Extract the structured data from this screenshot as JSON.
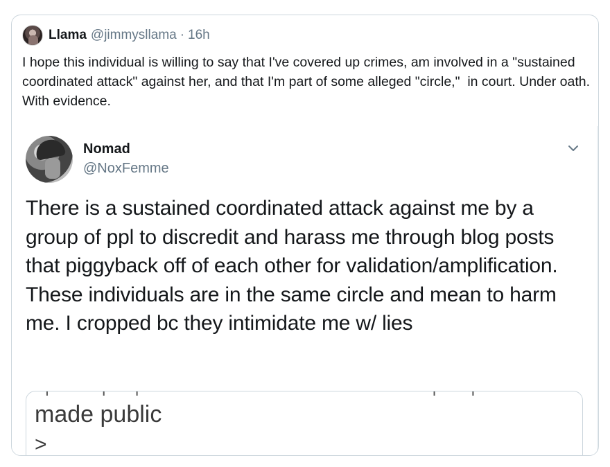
{
  "quote_tweet": {
    "name": "Llama",
    "handle": "@jimmysllama",
    "separator": "·",
    "time": "16h",
    "text": "I hope this individual is willing to say that I've covered up crimes, am involved in a \"sustained coordinated attack\" against her, and that I'm part of some alleged \"circle,\"  in court. Under oath. With evidence."
  },
  "embedded_tweet": {
    "name": "Nomad",
    "handle": "@NoxFemme",
    "text": "There is a sustained coordinated attack against me by a group of ppl to discredit and harass me through blog posts that piggyback off of each other for validation/amplification. These individuals are in the same circle and mean to harm me. I cropped bc they intimidate me w/ lies",
    "image_text_line1": "made public",
    "image_text_line2": ">"
  },
  "icons": {
    "menu": "chevron-down-icon"
  },
  "colors": {
    "secondary_text": "#657786",
    "border": "#ccd6dd",
    "accent_underline": "#d33f2a"
  }
}
